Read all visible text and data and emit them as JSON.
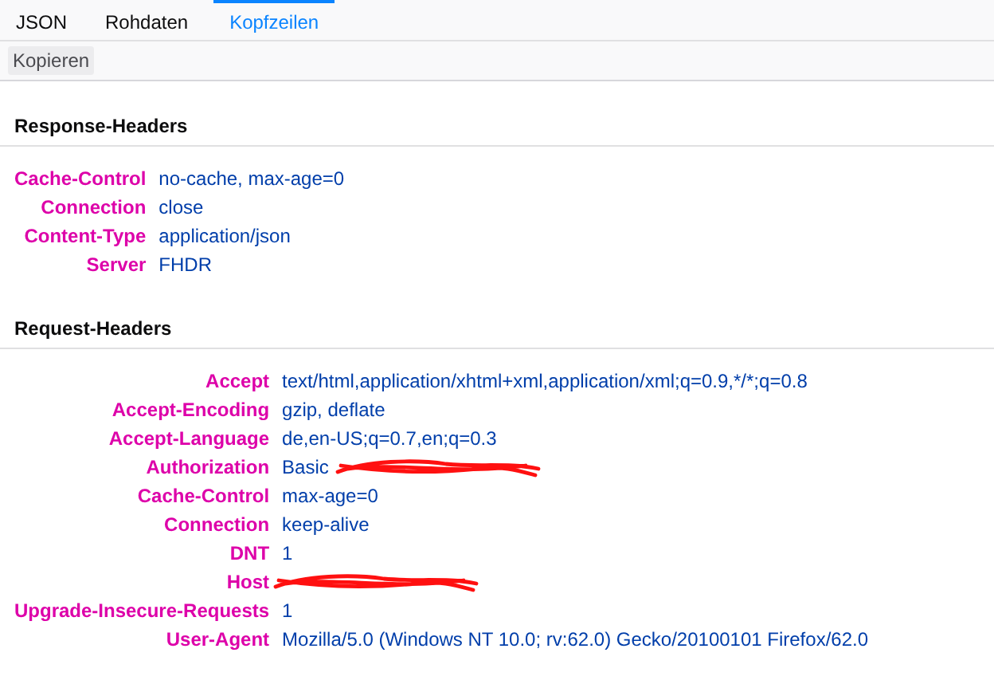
{
  "tabs": [
    {
      "label": "JSON",
      "selected": false
    },
    {
      "label": "Rohdaten",
      "selected": false
    },
    {
      "label": "Kopfzeilen",
      "selected": true
    }
  ],
  "toolbar": {
    "buttons": [
      "Kopieren"
    ]
  },
  "sections": [
    {
      "title": "Response-Headers",
      "rows": [
        {
          "name": "Cache-Control",
          "value": "no-cache, max-age=0",
          "redacted": false
        },
        {
          "name": "Connection",
          "value": "close",
          "redacted": false
        },
        {
          "name": "Content-Type",
          "value": "application/json",
          "redacted": false
        },
        {
          "name": "Server",
          "value": "FHDR",
          "redacted": false
        }
      ]
    },
    {
      "title": "Request-Headers",
      "rows": [
        {
          "name": "Accept",
          "value": "text/html,application/xhtml+xml,application/xml;q=0.9,*/*;q=0.8",
          "redacted": false
        },
        {
          "name": "Accept-Encoding",
          "value": "gzip, deflate",
          "redacted": false
        },
        {
          "name": "Accept-Language",
          "value": "de,en-US;q=0.7,en;q=0.3",
          "redacted": false
        },
        {
          "name": "Authorization",
          "value": "Basic",
          "redacted": true
        },
        {
          "name": "Cache-Control",
          "value": "max-age=0",
          "redacted": false
        },
        {
          "name": "Connection",
          "value": "keep-alive",
          "redacted": false
        },
        {
          "name": "DNT",
          "value": "1",
          "redacted": false
        },
        {
          "name": "Host",
          "redacted": true
        },
        {
          "name": "Upgrade-Insecure-Requests",
          "value": "1",
          "redacted": false
        },
        {
          "name": "User-Agent",
          "value": "Mozilla/5.0 (Windows NT 10.0; rv:62.0) Gecko/20100101 Firefox/62.0",
          "redacted": false
        }
      ]
    }
  ]
}
